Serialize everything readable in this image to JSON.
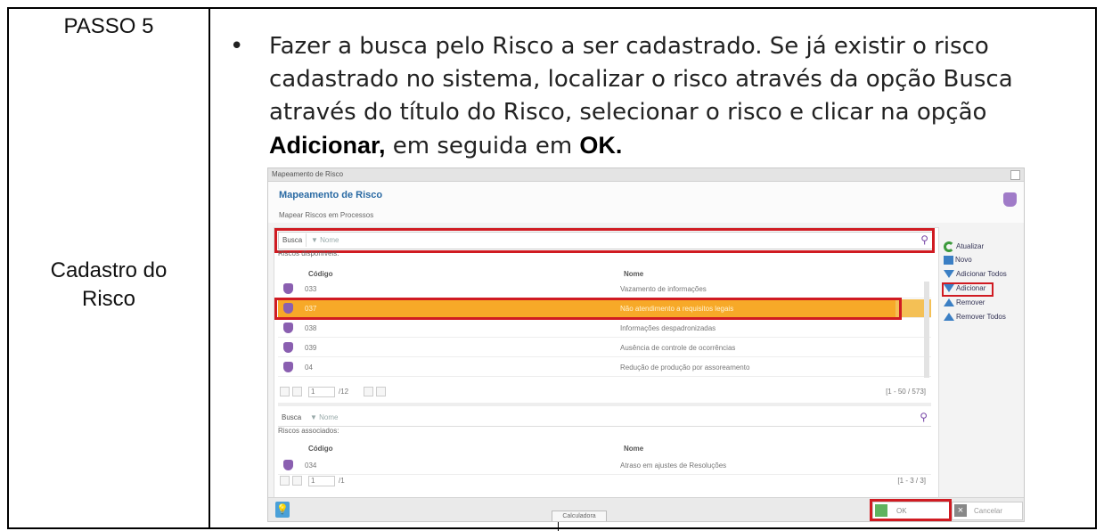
{
  "step": {
    "label": "PASSO 5",
    "section_line1": "Cadastro do",
    "section_line2": "Risco"
  },
  "instruction": {
    "text_before": "Fazer a busca pelo Risco a ser cadastrado. Se já existir o risco cadastrado no sistema, localizar o risco através da opção Busca através do título do Risco, selecionar o risco e clicar na opção ",
    "bold1": "Adicionar,",
    "text_mid": " em seguida em ",
    "bold2": "OK."
  },
  "app": {
    "window_title": "Mapeamento de Risco",
    "heading": "Mapeamento de Risco",
    "subheading": "Mapear Riscos em Processos",
    "search_label": "Busca",
    "search_placeholder": "Nome",
    "available_caption": "Riscos disponíveis:",
    "associated_caption": "Riscos associados:",
    "col_code": "Código",
    "col_name": "Nome",
    "available_rows": [
      {
        "code": "033",
        "name": "Vazamento de informações"
      },
      {
        "code": "037",
        "name": "Não atendimento a requisitos legais"
      },
      {
        "code": "038",
        "name": "Informações despadronizadas"
      },
      {
        "code": "039",
        "name": "Ausência de controle de ocorrências"
      },
      {
        "code": "04",
        "name": "Redução de produção por assoreamento"
      }
    ],
    "pager_top": {
      "page": "1",
      "of": "/12",
      "info": "[1 - 50 / 573]"
    },
    "associated_rows": [
      {
        "code": "034",
        "name": "Atraso em ajustes de Resoluções"
      }
    ],
    "pager_bottom": {
      "page": "1",
      "of": "/1",
      "info": "[1 - 3 / 3]"
    },
    "actions": [
      "Atualizar",
      "Novo",
      "Adicionar Todos",
      "Adicionar",
      "Remover",
      "Remover Todos"
    ],
    "calculator_label": "Calculadora",
    "ok_label": "OK",
    "cancel_label": "Cancelar",
    "colors": {
      "highlight": "#f7a928",
      "accent": "#2a6aa3",
      "annotation": "#d01b22"
    }
  }
}
